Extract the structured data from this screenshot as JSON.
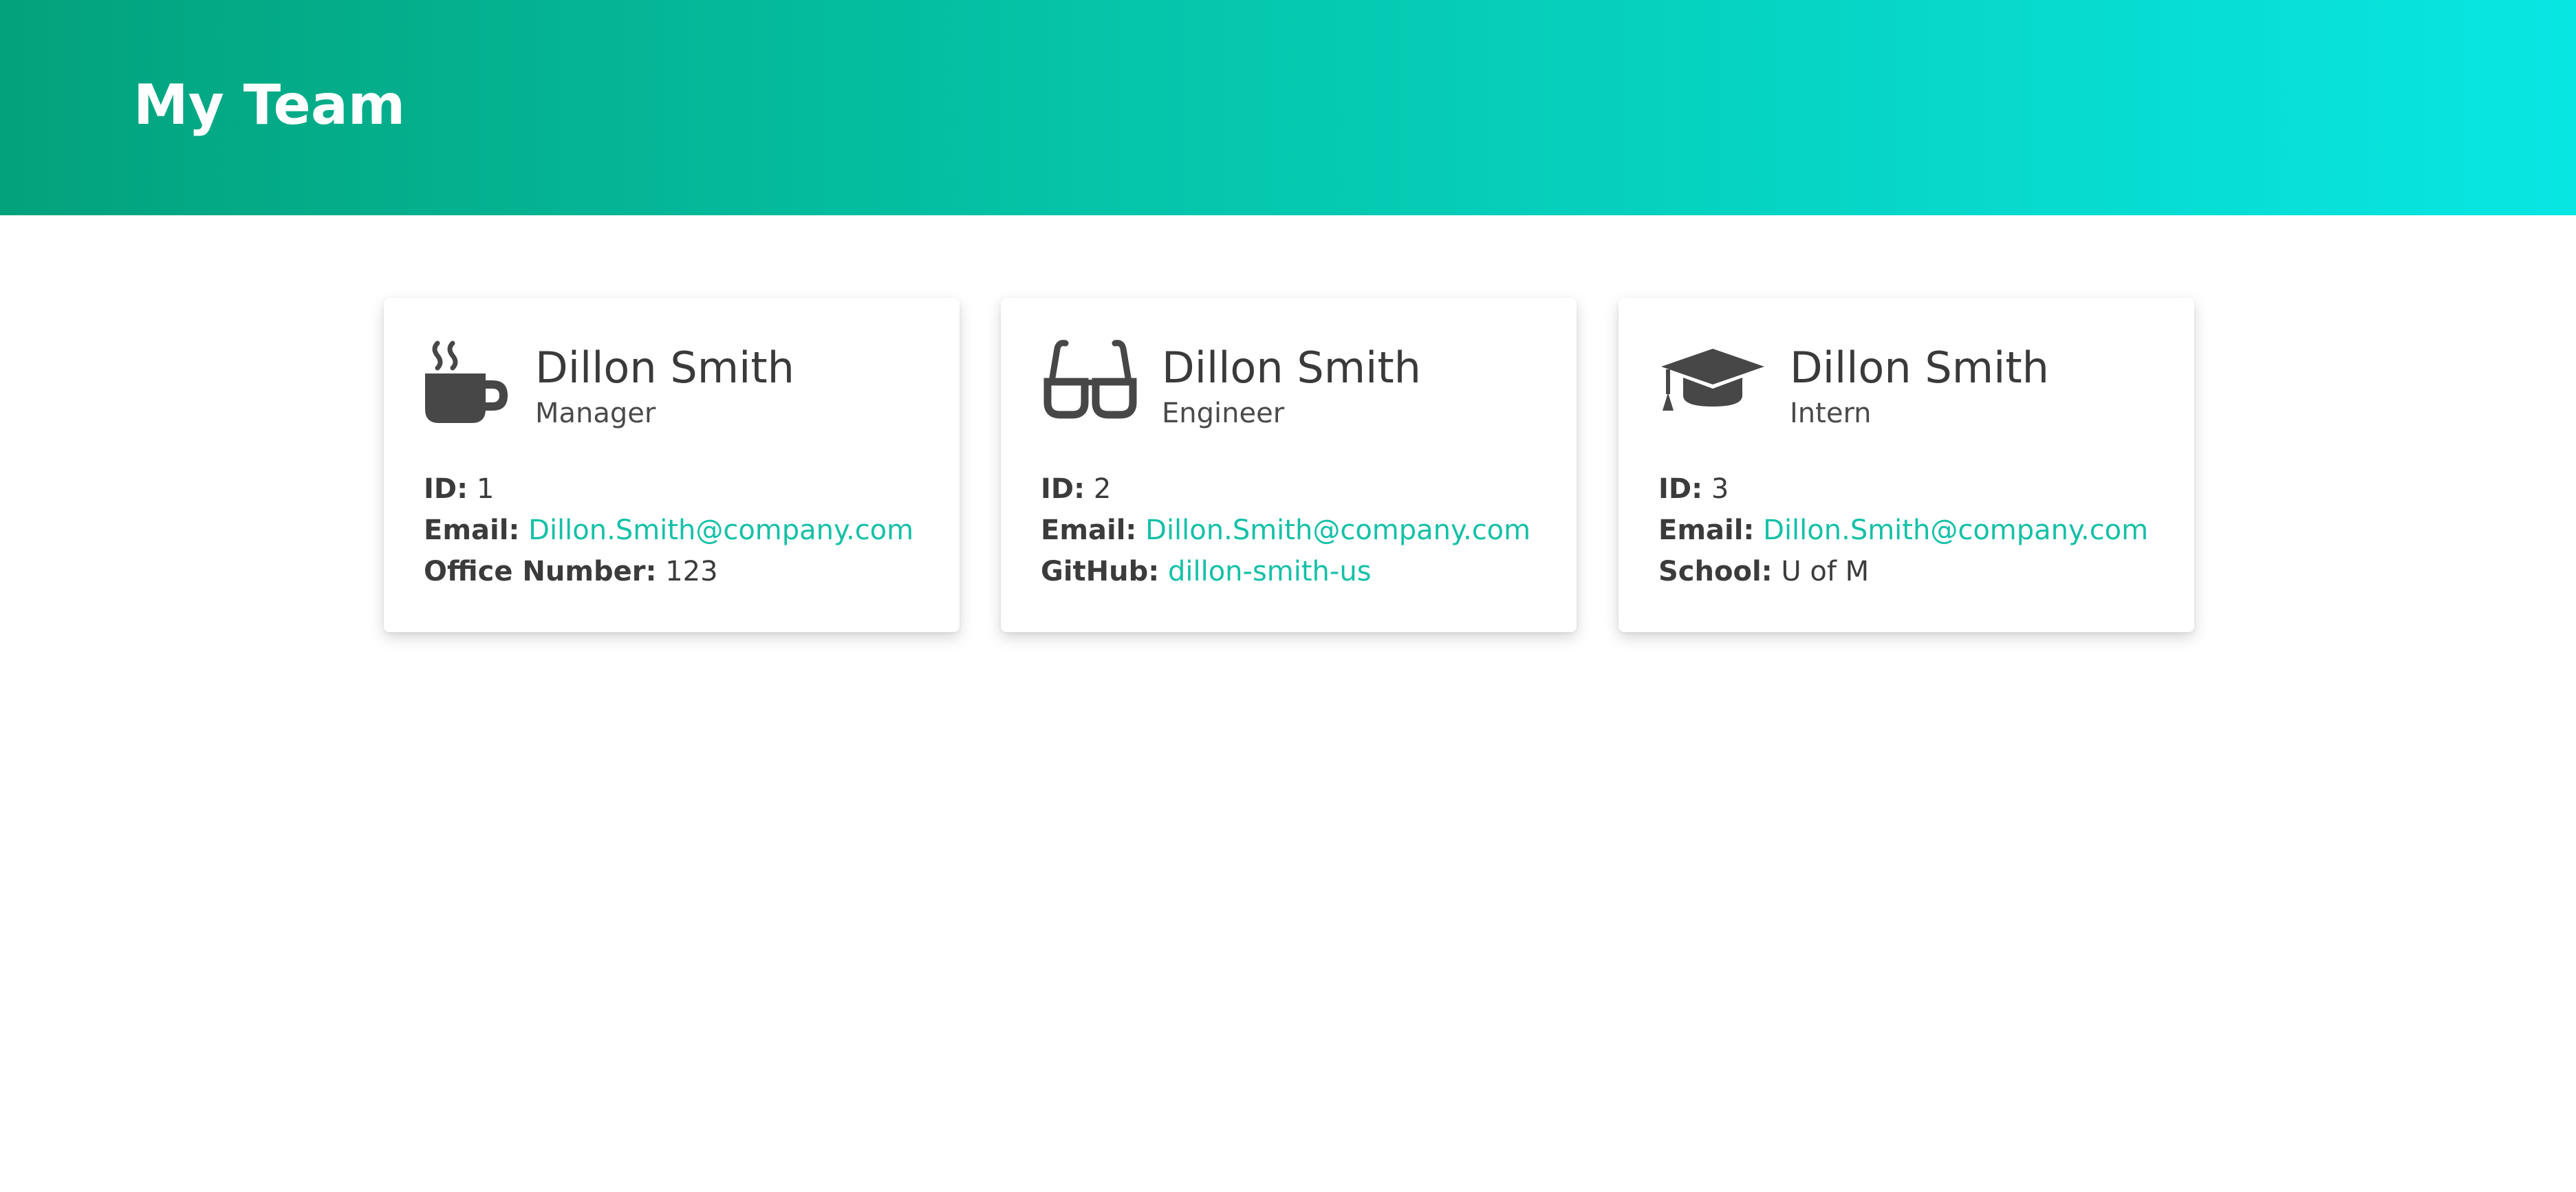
{
  "header": {
    "title": "My Team"
  },
  "theme": {
    "gradient_start": "#03a27c",
    "gradient_end": "#08e6e3",
    "link_color": "#14c0a7",
    "text_color": "#3b3b3b"
  },
  "cards": [
    {
      "icon": "coffee-cup-icon",
      "name": "Dillon Smith",
      "role": "Manager",
      "id_label": "ID:",
      "id_value": "1",
      "email_label": "Email:",
      "email": "Dillon.Smith@company.com",
      "extra_label": "Office Number:",
      "extra_value": "123"
    },
    {
      "icon": "glasses-icon",
      "name": "Dillon Smith",
      "role": "Engineer",
      "id_label": "ID:",
      "id_value": "2",
      "email_label": "Email:",
      "email": "Dillon.Smith@company.com",
      "extra_label": "GitHub:",
      "extra_value": "dillon-smith-us"
    },
    {
      "icon": "graduation-cap-icon",
      "name": "Dillon Smith",
      "role": "Intern",
      "id_label": "ID:",
      "id_value": "3",
      "email_label": "Email:",
      "email": "Dillon.Smith@company.com",
      "extra_label": "School:",
      "extra_value": "U of M"
    }
  ]
}
